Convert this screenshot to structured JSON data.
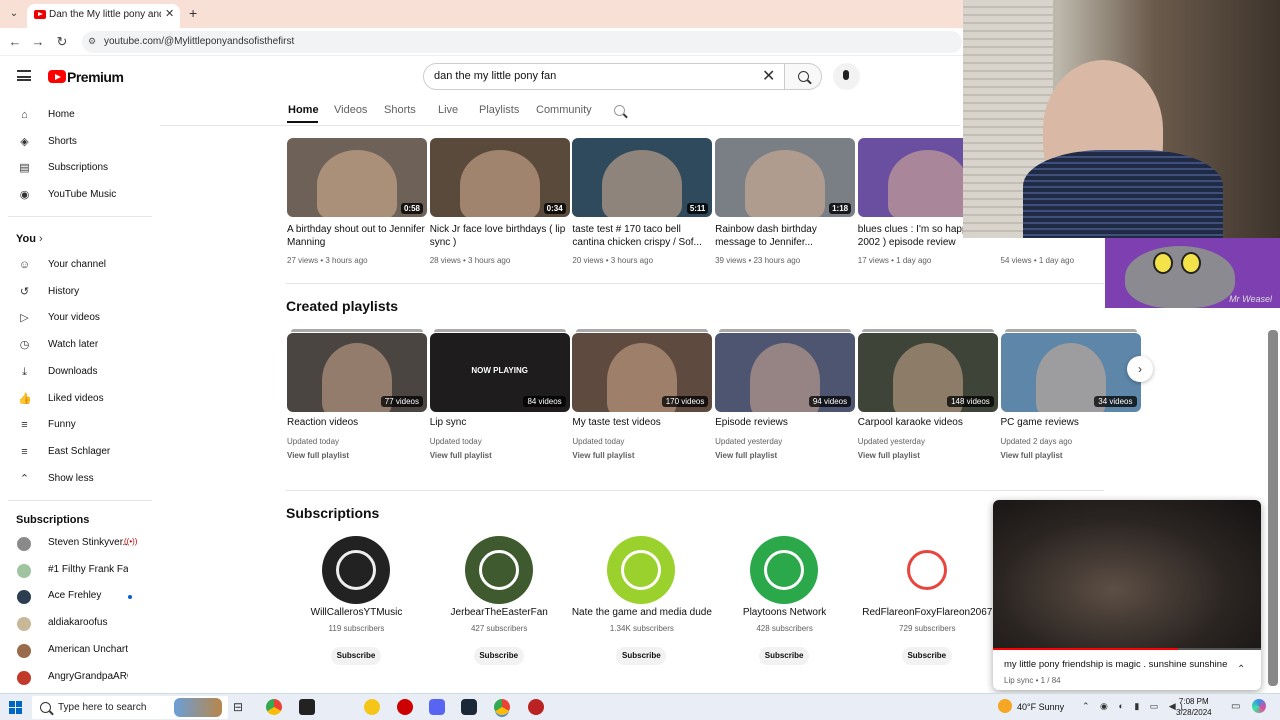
{
  "browser": {
    "tab_title": "Dan the My little pony and Sofia",
    "url": "youtube.com/@Mylittleponyandsofisthefirst"
  },
  "header": {
    "logo_text": "Premium",
    "search_value": "dan the my little pony fan"
  },
  "sidebar": {
    "main": [
      {
        "label": "Home",
        "icon": "home-icon",
        "glyph": "⌂"
      },
      {
        "label": "Shorts",
        "icon": "shorts-icon",
        "glyph": "◈"
      },
      {
        "label": "Subscriptions",
        "icon": "subscriptions-icon",
        "glyph": "▤"
      },
      {
        "label": "YouTube Music",
        "icon": "music-icon",
        "glyph": "◉"
      }
    ],
    "you_heading": "You",
    "you": [
      {
        "label": "Your channel",
        "icon": "channel-icon",
        "glyph": "☺"
      },
      {
        "label": "History",
        "icon": "history-icon",
        "glyph": "↺"
      },
      {
        "label": "Your videos",
        "icon": "your-videos-icon",
        "glyph": "▷"
      },
      {
        "label": "Watch later",
        "icon": "clock-icon",
        "glyph": "◷"
      },
      {
        "label": "Downloads",
        "icon": "download-icon",
        "glyph": "⤓"
      },
      {
        "label": "Liked videos",
        "icon": "thumbs-up-icon",
        "glyph": "👍"
      },
      {
        "label": "Funny",
        "icon": "playlist-icon",
        "glyph": "≡"
      },
      {
        "label": "East Schlager",
        "icon": "playlist-icon",
        "glyph": "≡"
      },
      {
        "label": "Show less",
        "icon": "chevron-up-icon",
        "glyph": "⌃"
      }
    ],
    "subs_heading": "Subscriptions",
    "subscriptions": [
      {
        "label": "Steven Stinkyver...",
        "color": "#8a8a8a",
        "badge": "live"
      },
      {
        "label": "#1 Filthy Frank Fan!...",
        "color": "#a0c4a0",
        "badge": ""
      },
      {
        "label": "Ace Frehley",
        "color": "#2c3e50",
        "badge": "dot"
      },
      {
        "label": "aldiakaroofus",
        "color": "#c8b89a",
        "badge": ""
      },
      {
        "label": "American Uncharte...",
        "color": "#9a6b4a",
        "badge": ""
      },
      {
        "label": "AngryGrandpaARC...",
        "color": "#c0392b",
        "badge": ""
      }
    ]
  },
  "channel_tabs": [
    "Home",
    "Videos",
    "Shorts",
    "Live",
    "Playlists",
    "Community"
  ],
  "videos": [
    {
      "title": "A birthday shout out to Jennifer Manning",
      "meta": "27 views • 3 hours ago",
      "duration": "0:58",
      "bg": "#6e6258"
    },
    {
      "title": "Nick Jr face love birthdays ( lip sync )",
      "meta": "28 views • 3 hours ago",
      "duration": "0:34",
      "bg": "#5a4a3c"
    },
    {
      "title": "taste test # 170 taco bell cantina chicken crispy / Sof...",
      "meta": "20 views • 3 hours ago",
      "duration": "5:11",
      "bg": "#2f4a5c"
    },
    {
      "title": "Rainbow dash birthday message to Jennifer...",
      "meta": "39 views • 23 hours ago",
      "duration": "1:18",
      "bg": "#7a7f86"
    },
    {
      "title": "blues clues : I'm so happy 2002 ) episode review",
      "meta": "17 views • 1 day ago",
      "duration": "",
      "bg": "#6a4fa0"
    },
    {
      "title": "2004 ) episode review",
      "meta": "54 views • 1 day ago",
      "duration": "",
      "bg": "#ddd"
    }
  ],
  "playlists_heading": "Created playlists",
  "playlists": [
    {
      "title": "Reaction videos",
      "updated": "Updated today",
      "count": "77 videos",
      "bg": "#4a4540",
      "overlay": ""
    },
    {
      "title": "Lip sync",
      "updated": "Updated today",
      "count": "84 videos",
      "bg": "#1e1c1c",
      "overlay": "NOW PLAYING"
    },
    {
      "title": "My taste test videos",
      "updated": "Updated today",
      "count": "170 videos",
      "bg": "#5e4a3e",
      "overlay": ""
    },
    {
      "title": "Episode reviews",
      "updated": "Updated yesterday",
      "count": "94 videos",
      "bg": "#4e5570",
      "overlay": ""
    },
    {
      "title": "Carpool karaoke videos",
      "updated": "Updated yesterday",
      "count": "148 videos",
      "bg": "#3e4438",
      "overlay": ""
    },
    {
      "title": "PC game reviews",
      "updated": "Updated 2 days ago",
      "count": "34 videos",
      "bg": "#5e86a8",
      "overlay": ""
    }
  ],
  "view_full_playlist": "View full playlist",
  "subscriptions_heading": "Subscriptions",
  "subscriptions": [
    {
      "name": "WillCallerosYTMusic",
      "count": "119 subscribers",
      "bg": "#222",
      "fg": "#eee"
    },
    {
      "name": "JerbearTheEasterFan",
      "count": "427 subscribers",
      "bg": "#3e5a2e",
      "fg": "#fff"
    },
    {
      "name": "Nate the game and media dude",
      "count": "1.34K subscribers",
      "bg": "#9bd12c",
      "fg": "#fff"
    },
    {
      "name": "Playtoons Network",
      "count": "428 subscribers",
      "bg": "#2aa84a",
      "fg": "#fff"
    },
    {
      "name": "RedFlareonFoxyFlareon2067",
      "count": "729 subscribers",
      "bg": "#fff",
      "fg": "#e8453c"
    }
  ],
  "subscribe_label": "Subscribe",
  "overlay": {
    "weasel_caption": "Mr Weasel"
  },
  "miniplayer": {
    "title": "my little pony friendship is magic . sunshine sunshine",
    "subtitle": "Lip sync • 1 / 84",
    "progress": 0.69
  },
  "taskbar": {
    "search_placeholder": "Type here to search",
    "weather": "40°F  Sunny",
    "time": "7:08 PM",
    "date": "3/28/2024"
  }
}
